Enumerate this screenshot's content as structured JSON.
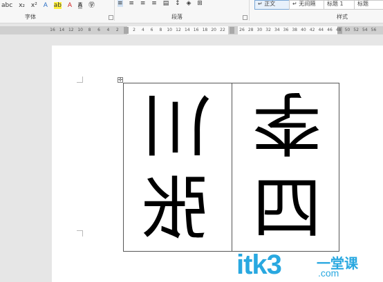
{
  "ribbon": {
    "font_tools": [
      "abc",
      "x₂",
      "x²",
      "A",
      "ab",
      "A",
      "A",
      "㊫"
    ],
    "para_tools": [
      "≡",
      "≡",
      "≡",
      "≡",
      "▤",
      "↕",
      "◈",
      "⊞"
    ],
    "group_font": "字体",
    "group_paragraph": "段落",
    "group_styles": "样式",
    "style_normal": "↵ 正文",
    "style_nospacing": "↵ 无间隔",
    "style_heading1": "标题 1",
    "style_heading2": "标题"
  },
  "ruler": {
    "left_numbers": [
      "16",
      "14",
      "12",
      "10",
      "8",
      "6",
      "4",
      "2"
    ],
    "mid_numbers": [
      "2",
      "4",
      "6",
      "8",
      "10",
      "12",
      "14",
      "16",
      "18",
      "20",
      "22"
    ],
    "right_numbers": [
      "26",
      "28",
      "30",
      "32",
      "34",
      "36",
      "38",
      "40",
      "42",
      "44",
      "46",
      "48",
      "50",
      "52",
      "54",
      "56"
    ]
  },
  "table": {
    "cells": [
      {
        "char": "川",
        "transform": "rotate"
      },
      {
        "char": "李",
        "transform": "rotate"
      },
      {
        "char": "张",
        "transform": "mirror"
      },
      {
        "char": "四",
        "transform": "mirror"
      }
    ]
  },
  "watermark": {
    "logo": "itk3",
    "cn": "一堂课",
    "domain": ".com"
  },
  "colors": {
    "watermark": "#29a8e0",
    "page": "#ffffff",
    "background": "#e6e6e6"
  }
}
